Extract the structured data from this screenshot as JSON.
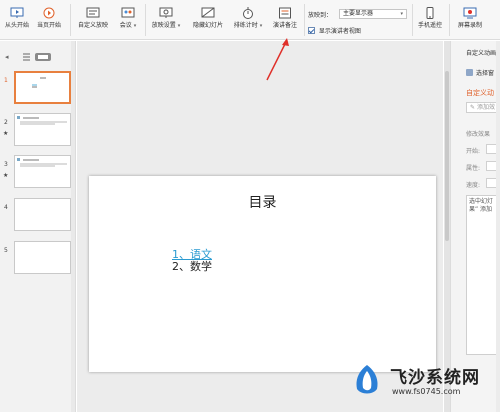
{
  "ribbon": {
    "buttons": [
      {
        "id": "from-start",
        "label": "从头开始",
        "icon": "play-screen-icon"
      },
      {
        "id": "from-current",
        "label": "当页开始",
        "icon": "play-circle-icon"
      },
      {
        "id": "custom-show",
        "label": "自定义放映",
        "icon": "custom-show-icon"
      },
      {
        "id": "meeting",
        "label": "会议",
        "icon": "meeting-icon"
      },
      {
        "id": "show-settings",
        "label": "放映设置",
        "icon": "settings-screen-icon"
      },
      {
        "id": "hide-slide",
        "label": "隐藏幻灯片",
        "icon": "hide-slide-icon"
      },
      {
        "id": "rehearse",
        "label": "排练计时",
        "icon": "stopwatch-icon"
      },
      {
        "id": "speaker-notes",
        "label": "演讲备注",
        "icon": "notes-icon"
      },
      {
        "id": "phone-remote",
        "label": "手机遥控",
        "icon": "phone-icon"
      },
      {
        "id": "screen-record",
        "label": "屏幕录制",
        "icon": "record-icon"
      }
    ],
    "play_to_label": "放映到：",
    "play_to_value": "主要显示器",
    "presenter_view_label": "显示演讲者视图",
    "presenter_view_checked": true
  },
  "thumbnails": {
    "items": [
      {
        "number": "1",
        "active": true,
        "has_animation": false
      },
      {
        "number": "2",
        "active": false,
        "has_animation": true
      },
      {
        "number": "3",
        "active": false,
        "has_animation": true
      },
      {
        "number": "4",
        "active": false,
        "has_animation": false
      },
      {
        "number": "5",
        "active": false,
        "has_animation": false
      }
    ],
    "animation_mark": "★"
  },
  "slide": {
    "title": "目录",
    "item1": "1、语文",
    "item2": "2、数学"
  },
  "right_panel": {
    "title": "自定义动画",
    "pane_select": "选择窗",
    "subtitle": "自定义动",
    "add_effect": "添加效",
    "modify_section": "修改效果",
    "start_label": "开始:",
    "property_label": "属性:",
    "speed_label": "速度:",
    "hint_text": "选中幻灯 果” 添加"
  },
  "watermark": {
    "name": "飞沙系统网",
    "url": "www.fs0745.com"
  },
  "colors": {
    "accent": "#e0612a",
    "thumb_active_border": "#e8803f",
    "link": "#2b9bd1",
    "arrow": "#e0302a"
  }
}
